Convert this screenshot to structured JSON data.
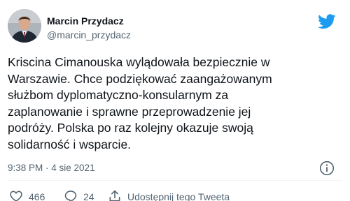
{
  "tweet": {
    "author": {
      "display_name": "Marcin Przydacz",
      "handle": "@marcin_przydacz",
      "avatar_icon": "avatar-photo"
    },
    "brand_icon": "twitter-bird-icon",
    "text": "Kriscina Cimanouska wylądowała bezpiecznie w\nWarszawie. Chce podziękować zaangażowanym\nsłużbom dyplomatyczno-konsularnym za\nzaplanowanie i sprawne przeprowadzenie jej\npodróży. Polska po raz kolejny okazuje swoją\nsolidarność i wsparcie.",
    "timestamp": "9:38 PM · 4 sie 2021",
    "info_icon": "info-icon",
    "actions": {
      "likes": "466",
      "replies": "24",
      "share_label": "Udostępnij tego Tweeta"
    }
  },
  "colors": {
    "brand": "#1d9bf0",
    "text_primary": "#0f1419",
    "text_secondary": "#536471",
    "divider": "#eff3f4"
  }
}
